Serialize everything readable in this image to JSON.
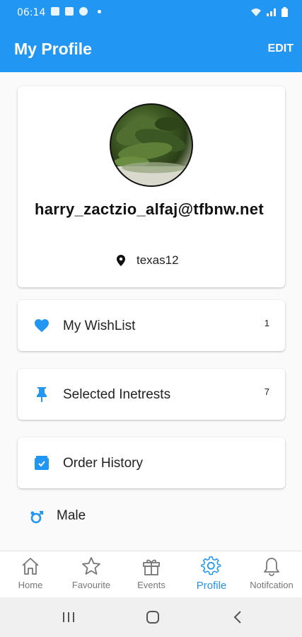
{
  "status_bar": {
    "time": "06:14"
  },
  "app_bar": {
    "title": "My Profile",
    "edit_label": "EDIT"
  },
  "profile": {
    "email": "harry_zactzio_alfaj@tfbnw.net",
    "location": "texas12"
  },
  "menu": {
    "wishlist": {
      "label": "My WishList",
      "count": "1"
    },
    "interests": {
      "label": "Selected Inetrests",
      "count": "7"
    },
    "orders": {
      "label": "Order History"
    }
  },
  "gender": {
    "label": "Male"
  },
  "bottom_nav": {
    "items": [
      {
        "label": "Home",
        "icon": "home-icon"
      },
      {
        "label": "Favourite",
        "icon": "star-icon"
      },
      {
        "label": "Events",
        "icon": "gift-icon"
      },
      {
        "label": "Profile",
        "icon": "gear-icon",
        "active": true
      },
      {
        "label": "Notifcation",
        "icon": "bell-icon"
      }
    ]
  },
  "colors": {
    "primary": "#2196f3",
    "inactive": "#777777"
  }
}
